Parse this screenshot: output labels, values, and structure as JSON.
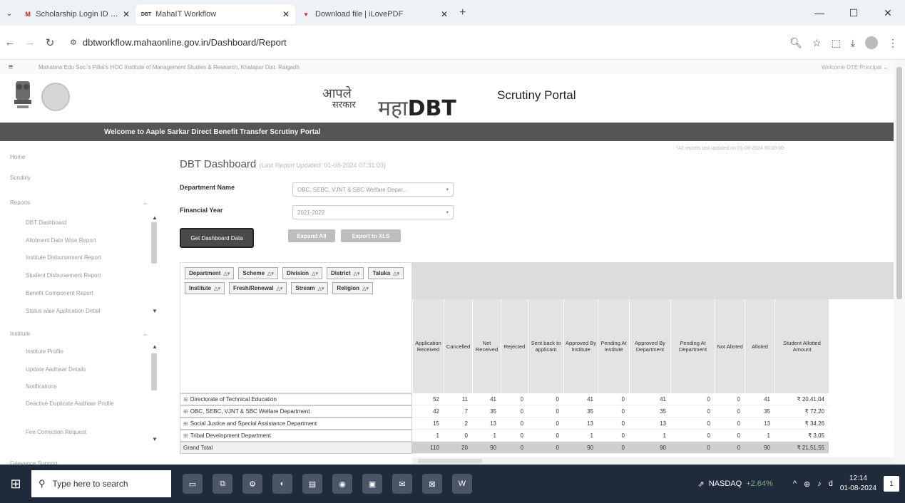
{
  "browser": {
    "tabs": [
      {
        "title": "Scholarship Login ID and Passw",
        "favicon": "M"
      },
      {
        "title": "MahaIT Workflow",
        "favicon": "DBT"
      },
      {
        "title": "Download file | iLovePDF",
        "favicon": "♥"
      }
    ],
    "tab_list_icon": "⌄",
    "new_tab": "+",
    "url": "dbtworkflow.mahaonline.gov.in/Dashboard/Report",
    "window_controls": {
      "minimize": "—",
      "restore": "☐",
      "close": "✕"
    }
  },
  "institute": {
    "name": "Mahatma Edu Soc.'s Pillai's HOC Institute of Management Studies & Research, Khalapur Dist. Raigadh",
    "welcome_user": "Welcome DTE Principal ⌄"
  },
  "brand": {
    "aaple_line1": "आपले",
    "aaple_line2": "सरकार",
    "maha": "महा",
    "dbt": "DBT",
    "portal": "Scrutiny Portal"
  },
  "welcome_banner": "Welcome to Aaple Sarkar Direct Benefit Transfer Scrutiny Portal",
  "sidebar": {
    "home": "Home",
    "scrutiny": "Scrutiny",
    "reports": "Reports",
    "report_items": [
      "DBT Dashboard",
      "Allotment Date Wise Report",
      "Institute Disbursement Report",
      "Student Disbursement Report",
      "Benefit Component Report",
      "Status wise Application Detail"
    ],
    "institute": "Institute",
    "institute_items": [
      "Institute Profile",
      "Update Aadhaar Details",
      "Notifications",
      "Deactive Duplicate Aadhaar Profile",
      "Fee Correction Request"
    ],
    "grievance": "Grievance Support"
  },
  "dashboard": {
    "title": "DBT Dashboard",
    "last_updated": "(Last Report Updated: 01-08-2024 07:31:03)",
    "all_reports_note": "*All reports last updated on 01-08-2024 00:00:00",
    "department_label": "Department Name",
    "department_value": "OBC, SEBC, VJNT & SBC Welfare Depar...",
    "year_label": "Financial Year",
    "year_value": "2021-2022",
    "get_data_button": "Get Dashboard Data",
    "expand_all_button": "Expand All",
    "export_button": "Export to XLS"
  },
  "pivot": {
    "fields": [
      "Department",
      "Scheme",
      "Division",
      "District",
      "Taluka",
      "Institute",
      "Fresh/Renewal",
      "Stream",
      "Religion"
    ],
    "columns": [
      "Application Received",
      "Cancelled",
      "Net Received",
      "Rejected",
      "Sent back to applicant",
      "Approved By Institute",
      "Pending At Institute",
      "Approved By Department",
      "Pending At Department",
      "Not Alloted",
      "Alloted",
      "Student Allotted Amount"
    ],
    "rows": [
      {
        "label": "Directorate of Technical Education",
        "values": [
          "52",
          "11",
          "41",
          "0",
          "0",
          "41",
          "0",
          "41",
          "0",
          "0",
          "41",
          "₹ 20,41,04"
        ]
      },
      {
        "label": "OBC, SEBC, VJNT & SBC Welfare Department",
        "values": [
          "42",
          "7",
          "35",
          "0",
          "0",
          "35",
          "0",
          "35",
          "0",
          "0",
          "35",
          "₹ 72,20"
        ]
      },
      {
        "label": "Social Justice and Special Assistance Department",
        "values": [
          "15",
          "2",
          "13",
          "0",
          "0",
          "13",
          "0",
          "13",
          "0",
          "0",
          "13",
          "₹ 34,26"
        ]
      },
      {
        "label": "Tribal Development Department",
        "values": [
          "1",
          "0",
          "1",
          "0",
          "0",
          "1",
          "0",
          "1",
          "0",
          "0",
          "1",
          "₹ 3,05"
        ]
      }
    ],
    "total": {
      "label": "Grand Total",
      "values": [
        "110",
        "20",
        "90",
        "0",
        "0",
        "90",
        "0",
        "90",
        "0",
        "0",
        "90",
        "₹ 21,51,55"
      ]
    }
  },
  "taskbar": {
    "search_placeholder": "Type here to search",
    "ticker_name": "NASDAQ",
    "ticker_change": "+2.64%",
    "time": "12:14",
    "date": "01-08-2024",
    "notification_count": "1"
  }
}
